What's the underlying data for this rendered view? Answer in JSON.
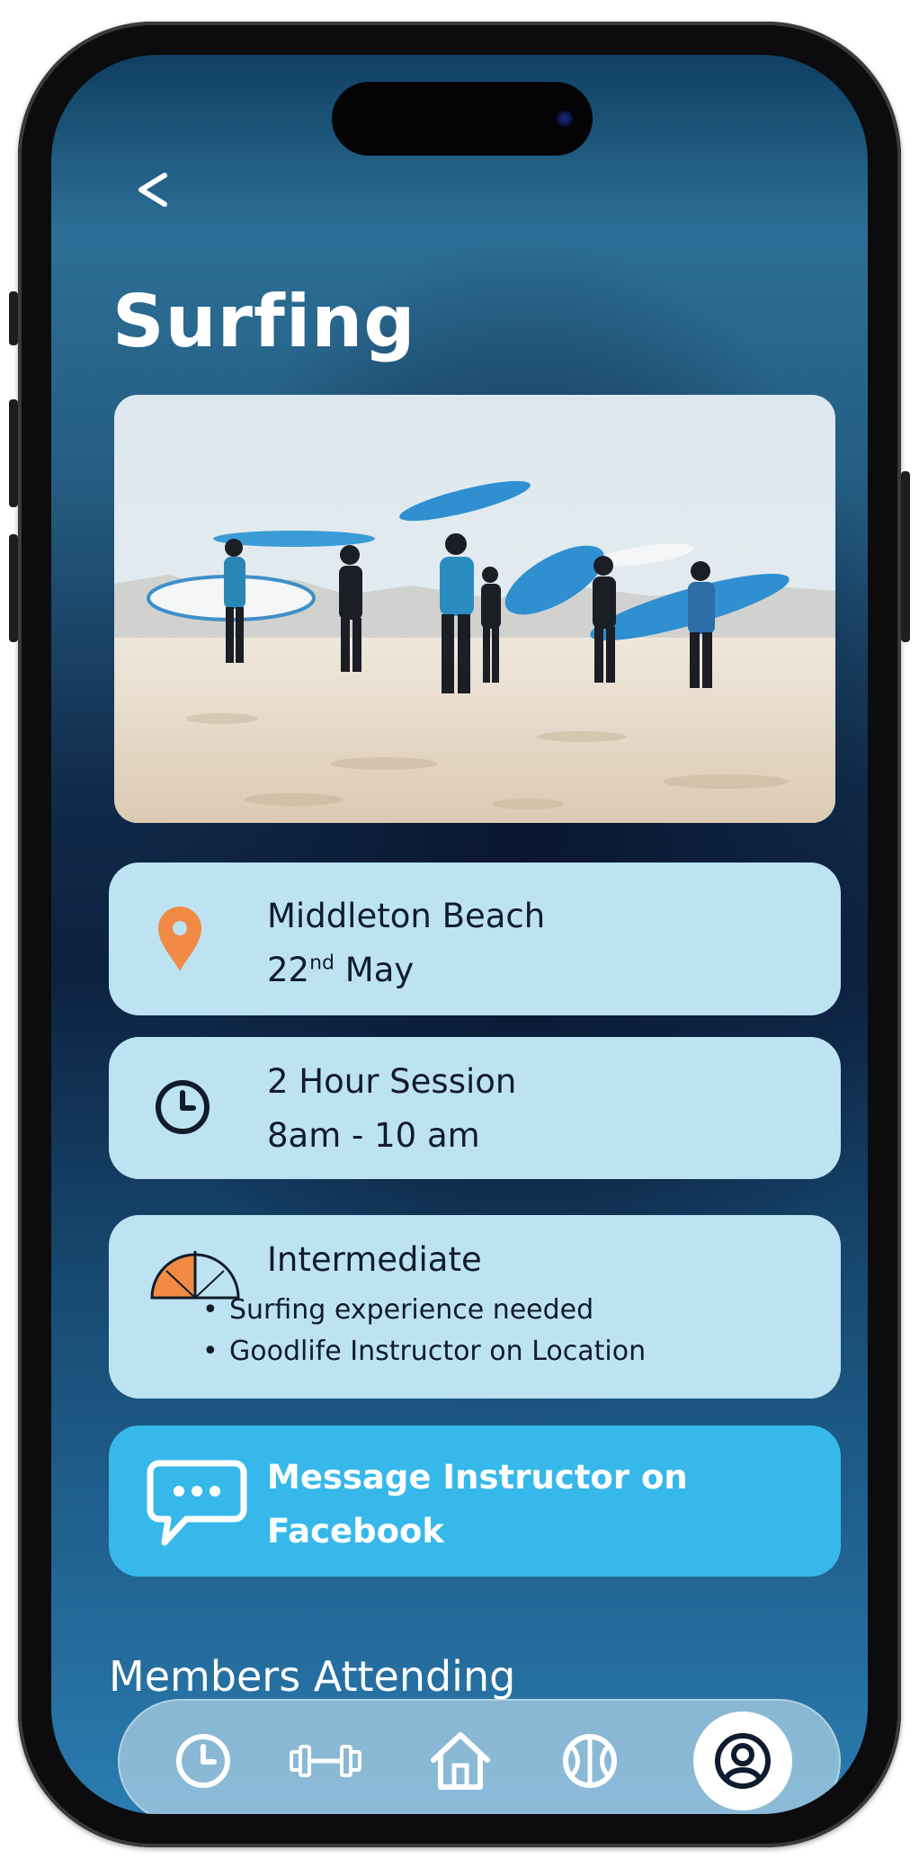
{
  "header": {
    "back_label": "<",
    "title": "Surfing"
  },
  "location_card": {
    "icon": "location-pin-icon",
    "place": "Middleton Beach",
    "date_day": "22",
    "date_suffix": "nd",
    "date_month": "May"
  },
  "session_card": {
    "icon": "clock-icon",
    "duration": "2 Hour Session",
    "time": "8am - 10 am"
  },
  "level_card": {
    "icon": "difficulty-gauge-icon",
    "level": "Intermediate",
    "requirements": [
      "Surfing experience needed",
      "Goodlife Instructor on Location"
    ]
  },
  "message_button": {
    "icon": "chat-bubble-icon",
    "line1": "Message Instructor on",
    "line2": "Facebook"
  },
  "members": {
    "heading": "Members Attending"
  },
  "bottom_nav": {
    "items": [
      {
        "icon": "clock-icon"
      },
      {
        "icon": "dumbbell-icon"
      },
      {
        "icon": "home-icon"
      },
      {
        "icon": "ball-icon"
      },
      {
        "icon": "profile-icon",
        "active": true
      }
    ]
  },
  "colors": {
    "card_bg": "#bde3f3",
    "accent_orange": "#f08a44",
    "message_bg": "#37b8ea",
    "text_dark": "#111c2a"
  }
}
